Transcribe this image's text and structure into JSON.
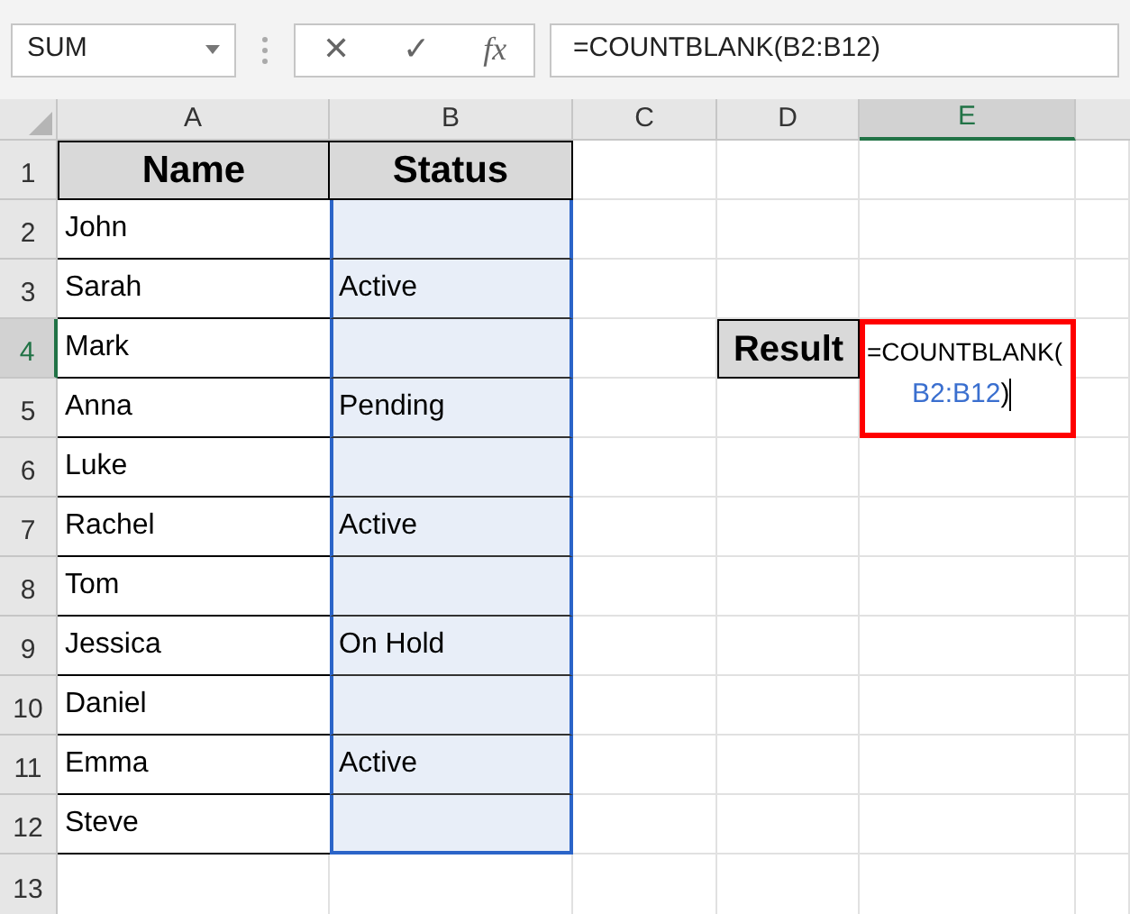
{
  "name_box": "SUM",
  "formula_bar": {
    "cancel": "✕",
    "enter": "✓",
    "fx": "fx",
    "value": "=COUNTBLANK(B2:B12)"
  },
  "columns": [
    {
      "label": "A",
      "selected": false
    },
    {
      "label": "B",
      "selected": false
    },
    {
      "label": "C",
      "selected": false
    },
    {
      "label": "D",
      "selected": false
    },
    {
      "label": "E",
      "selected": true
    }
  ],
  "rows": [
    {
      "number": "1",
      "selected": false,
      "name": "Name",
      "status": "Status",
      "kind": "header"
    },
    {
      "number": "2",
      "selected": false,
      "name": "John",
      "status": "",
      "kind": "data"
    },
    {
      "number": "3",
      "selected": false,
      "name": "Sarah",
      "status": "Active",
      "kind": "data"
    },
    {
      "number": "4",
      "selected": true,
      "name": "Mark",
      "status": "",
      "kind": "data",
      "result_label": "Result"
    },
    {
      "number": "5",
      "selected": false,
      "name": "Anna",
      "status": "Pending",
      "kind": "data"
    },
    {
      "number": "6",
      "selected": false,
      "name": "Luke",
      "status": "",
      "kind": "data"
    },
    {
      "number": "7",
      "selected": false,
      "name": "Rachel",
      "status": "Active",
      "kind": "data"
    },
    {
      "number": "8",
      "selected": false,
      "name": "Tom",
      "status": "",
      "kind": "data"
    },
    {
      "number": "9",
      "selected": false,
      "name": "Jessica",
      "status": "On Hold",
      "kind": "data"
    },
    {
      "number": "10",
      "selected": false,
      "name": "Daniel",
      "status": "",
      "kind": "data"
    },
    {
      "number": "11",
      "selected": false,
      "name": "Emma",
      "status": "Active",
      "kind": "data"
    },
    {
      "number": "12",
      "selected": false,
      "name": "Steve",
      "status": "",
      "kind": "data"
    },
    {
      "number": "13",
      "selected": false,
      "kind": "empty"
    }
  ],
  "editing_cell": {
    "parts": [
      {
        "text": "=COUNTBLANK(",
        "kind": "function"
      },
      {
        "text": "B2:B12",
        "kind": "reference"
      },
      {
        "text": ")",
        "kind": "function"
      }
    ]
  }
}
